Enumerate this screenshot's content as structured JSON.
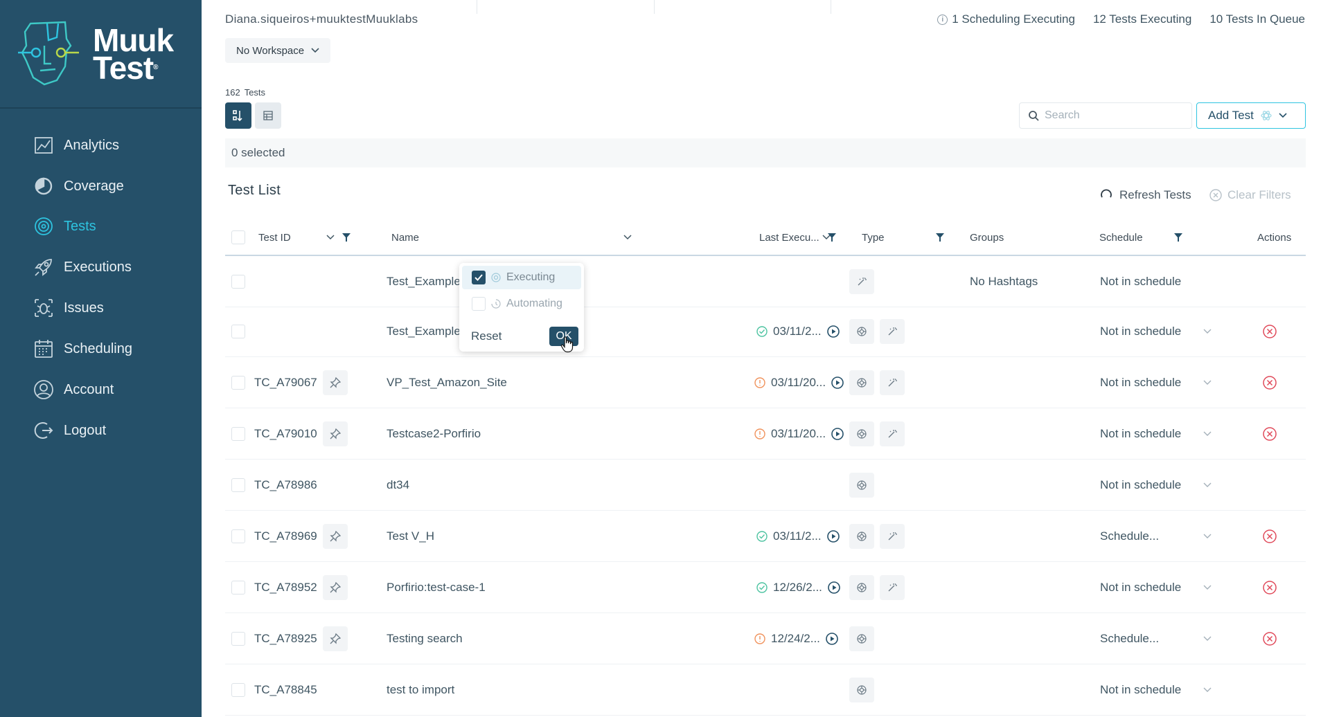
{
  "brand": {
    "line1": "Muuk",
    "line2": "Test",
    "reg": "®"
  },
  "sidebar": {
    "items": [
      {
        "label": "Analytics",
        "icon": "analytics-icon"
      },
      {
        "label": "Coverage",
        "icon": "coverage-icon"
      },
      {
        "label": "Tests",
        "icon": "tests-icon",
        "active": true
      },
      {
        "label": "Executions",
        "icon": "rocket-icon"
      },
      {
        "label": "Issues",
        "icon": "bug-icon"
      },
      {
        "label": "Scheduling",
        "icon": "calendar-icon"
      },
      {
        "label": "Account",
        "icon": "user-icon"
      },
      {
        "label": "Logout",
        "icon": "logout-icon"
      }
    ]
  },
  "header": {
    "user": "Diana.siqueiros+muuktestMuuklabs",
    "scheduling": "1 Scheduling Executing",
    "tests_executing": "12 Tests Executing",
    "tests_queue": "10 Tests In Queue",
    "workspace": "No Workspace"
  },
  "toolbar": {
    "count_number": "162",
    "count_label": "Tests",
    "search_placeholder": "Search",
    "add_test": "Add Test",
    "selected": "0 selected"
  },
  "list": {
    "title": "Test List",
    "refresh": "Refresh Tests",
    "clear": "Clear Filters",
    "columns": {
      "test_id": "Test ID",
      "name": "Name",
      "last_execution": "Last Execu...",
      "type": "Type",
      "groups": "Groups",
      "schedule": "Schedule",
      "actions": "Actions"
    },
    "rows": [
      {
        "id": "",
        "name": "Test_Example_VP",
        "date": "",
        "status": "",
        "type_exec": false,
        "type_edit": true,
        "groups": "No Hashtags",
        "schedule": "Not in schedule",
        "has_chevron": false,
        "has_delete": false,
        "has_pin": false
      },
      {
        "id": "",
        "name": "Test_Example_VP",
        "date": "03/11/2...",
        "status": "ok",
        "type_exec": true,
        "type_edit": true,
        "groups": "",
        "schedule": "Not in schedule",
        "has_chevron": true,
        "has_delete": true,
        "has_pin": false
      },
      {
        "id": "TC_A79067",
        "name": "VP_Test_Amazon_Site",
        "date": "03/11/20...",
        "status": "warn",
        "type_exec": true,
        "type_edit": true,
        "groups": "",
        "schedule": "Not in schedule",
        "has_chevron": true,
        "has_delete": true,
        "has_pin": true
      },
      {
        "id": "TC_A79010",
        "name": "Testcase2-Porfirio",
        "date": "03/11/20...",
        "status": "warn",
        "type_exec": true,
        "type_edit": true,
        "groups": "",
        "schedule": "Not in schedule",
        "has_chevron": true,
        "has_delete": true,
        "has_pin": true
      },
      {
        "id": "TC_A78986",
        "name": "dt34",
        "date": "",
        "status": "",
        "type_exec": true,
        "type_edit": false,
        "groups": "",
        "schedule": "Not in schedule",
        "has_chevron": true,
        "has_delete": false,
        "has_pin": false
      },
      {
        "id": "TC_A78969",
        "name": "Test V_H",
        "date": "03/11/2...",
        "status": "ok",
        "type_exec": true,
        "type_edit": true,
        "groups": "",
        "schedule": "Schedule...",
        "has_chevron": true,
        "has_delete": true,
        "has_pin": true
      },
      {
        "id": "TC_A78952",
        "name": "Porfirio:test-case-1",
        "date": "12/26/2...",
        "status": "ok",
        "type_exec": true,
        "type_edit": true,
        "groups": "",
        "schedule": "Not in schedule",
        "has_chevron": true,
        "has_delete": true,
        "has_pin": true
      },
      {
        "id": "TC_A78925",
        "name": "Testing search",
        "date": "12/24/2...",
        "status": "warn",
        "type_exec": true,
        "type_edit": false,
        "groups": "",
        "schedule": "Schedule...",
        "has_chevron": true,
        "has_delete": true,
        "has_pin": true
      },
      {
        "id": "TC_A78845",
        "name": "test to import",
        "date": "",
        "status": "",
        "type_exec": true,
        "type_edit": false,
        "groups": "",
        "schedule": "Not in schedule",
        "has_chevron": true,
        "has_delete": false,
        "has_pin": false
      }
    ]
  },
  "filter_dropdown": {
    "options": [
      {
        "label": "Executing",
        "checked": true
      },
      {
        "label": "Automating",
        "checked": false
      }
    ],
    "reset": "Reset",
    "ok": "OK"
  },
  "colors": {
    "sidebar": "#255069",
    "accent": "#2ec4e0",
    "ok": "#4cc3a0",
    "warn": "#f0925c",
    "danger": "#e04a5a"
  }
}
